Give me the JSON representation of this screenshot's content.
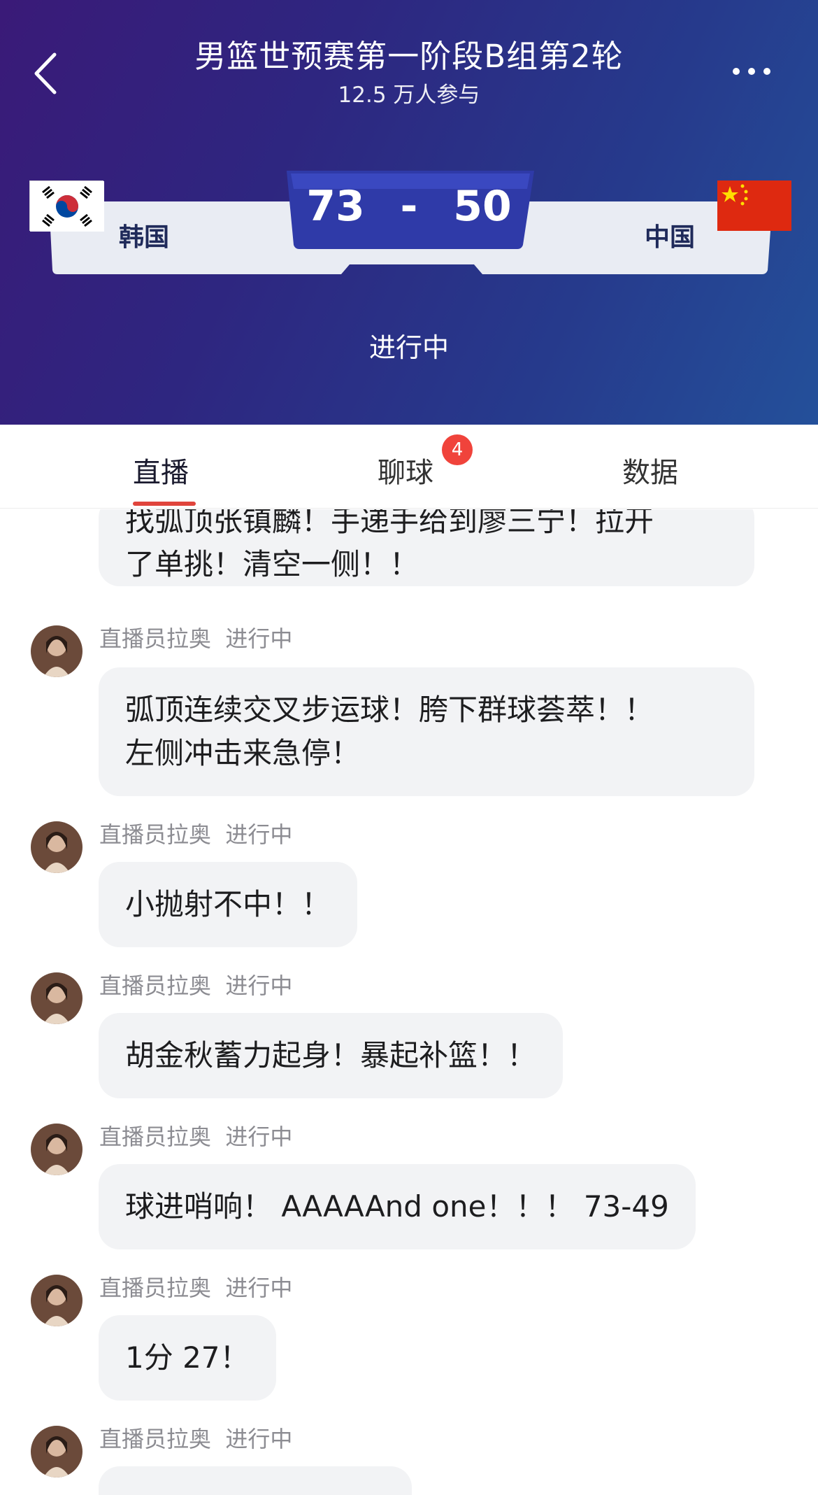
{
  "header": {
    "title": "男篮世预赛第一阶段B组第2轮",
    "participants": "12.5 万人参与",
    "status": "进行中"
  },
  "match": {
    "home_team": "韩国",
    "away_team": "中国",
    "home_score": "73",
    "separator": "-",
    "away_score": "50"
  },
  "tabs": [
    {
      "label": "直播",
      "active": true
    },
    {
      "label": "聊球",
      "badge": "4"
    },
    {
      "label": "数据"
    }
  ],
  "feed": {
    "partial_message": "找弧顶张镇麟！手递手给到廖三宁！拉开了单挑！清空一侧！！",
    "partial_line1": "找弧顶张镇麟！手递手给到廖三宁！拉开",
    "partial_line2": "了单挑！清空一侧！！",
    "messages": [
      {
        "author": "直播员拉奥",
        "status": "进行中",
        "line1": "弧顶连续交叉步运球！胯下群球荟萃！！",
        "line2": "左侧冲击来急停！"
      },
      {
        "author": "直播员拉奥",
        "status": "进行中",
        "line1": "小抛射不中！！"
      },
      {
        "author": "直播员拉奥",
        "status": "进行中",
        "line1": "胡金秋蓄力起身！暴起补篮！！"
      },
      {
        "author": "直播员拉奥",
        "status": "进行中",
        "line1": "球进哨响！ AAAAAnd one！！！ 73-49"
      },
      {
        "author": "直播员拉奥",
        "status": "进行中",
        "line1": "1分 27！"
      },
      {
        "author": "直播员拉奥",
        "status": "进行中",
        "line1": ""
      }
    ]
  },
  "colors": {
    "header_start": "#3a1a78",
    "header_end": "#24509a",
    "score_box": "#2f3aa8",
    "accent_red": "#e0443c",
    "bubble_bg": "#f2f3f5"
  },
  "icons": [
    "back-arrow-icon",
    "more-dots-icon",
    "korea-flag-icon",
    "china-flag-icon",
    "avatar-icon"
  ]
}
